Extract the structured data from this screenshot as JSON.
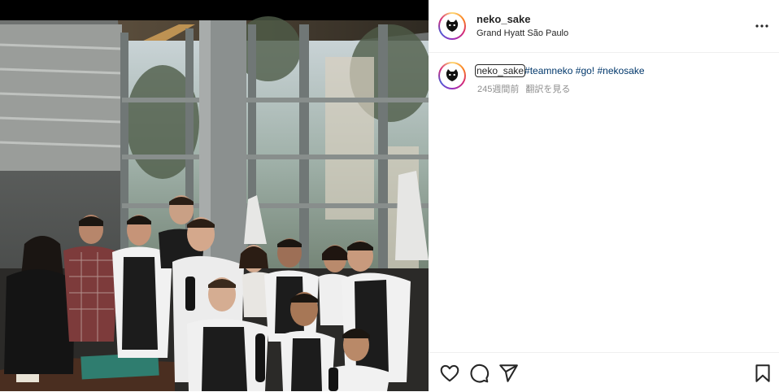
{
  "post": {
    "username": "neko_sake",
    "location": "Grand Hyatt São Paulo",
    "caption_user": "neko_sake",
    "hashtags": [
      "#teamneko",
      "#go!",
      "#nekosake"
    ],
    "time_ago": "245週間前",
    "translate_label": "翻訳を見る"
  },
  "icons": {
    "avatar": "cat-face-icon",
    "more": "more-options-icon",
    "like": "heart-icon",
    "comment": "comment-icon",
    "share": "paper-plane-icon",
    "save": "bookmark-icon"
  },
  "colors": {
    "hashtag": "#00376b",
    "muted": "#8e8e8e",
    "text": "#262626"
  }
}
